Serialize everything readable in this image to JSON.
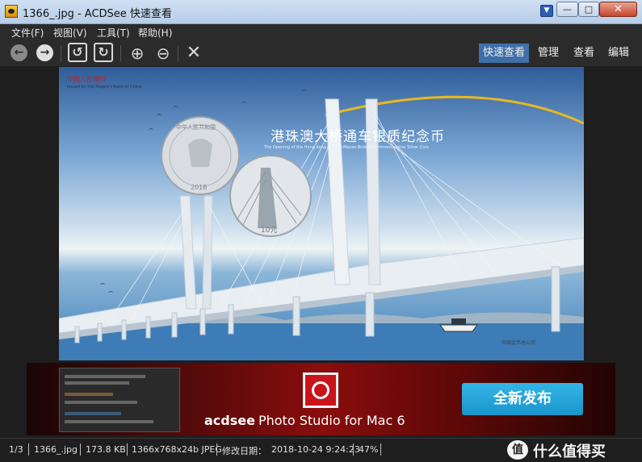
{
  "window": {
    "title": "1366_.jpg - ACDSee 快速查看",
    "minimize": "—",
    "maximize": "□",
    "close": "✕",
    "dropdown": "▼"
  },
  "menu": [
    {
      "label": "文件(F)"
    },
    {
      "label": "视图(V)"
    },
    {
      "label": "工具(T)"
    },
    {
      "label": "帮助(H)"
    }
  ],
  "toolbar": {
    "icons": {
      "back": "arrow-left-icon",
      "forward": "arrow-right-icon",
      "rotate_left": "rotate-left-icon",
      "rotate_right": "rotate-right-icon",
      "zoom_in": "zoom-in-icon",
      "zoom_out": "zoom-out-icon",
      "delete": "close-icon"
    },
    "glyphs": {
      "back": "←",
      "forward": "→",
      "rotate_left": "↺",
      "rotate_right": "↻",
      "zoom_in": "⊕",
      "zoom_out": "⊖",
      "delete": "✕"
    },
    "modes": [
      {
        "label": "快速查看",
        "active": true
      },
      {
        "label": "管理",
        "active": false
      },
      {
        "label": "查看",
        "active": false
      },
      {
        "label": "编辑",
        "active": false
      }
    ]
  },
  "photo": {
    "issuer_cn": "中国人民银行",
    "issuer_en": "Issued by the People's Bank of China",
    "headline_cn": "港珠澳大桥通车银质纪念币",
    "headline_en": "The Opening of the Hong Kong-Zhuhai-Macao Bridge Commemorative Silver Coin",
    "coin_front_text": "中华人民共和国",
    "coin_year": "2018",
    "coin_denomination": "10元",
    "maker_cn": "中国金币总公司",
    "colors": {
      "sky_top": "#2f5d9a",
      "bridge": "#e8eef3",
      "gold_arc": "#e8b820"
    }
  },
  "banner": {
    "cta_label": "全新发布",
    "product_brand": "acdsee",
    "product_name": "Photo Studio for Mac 6",
    "colors": {
      "bg": "#8a0d0d",
      "cta": "#1a95cc",
      "logo": "#c8141a"
    }
  },
  "status": {
    "index": "1/3",
    "filename": "1366_.jpg",
    "filesize": "173.8 KB",
    "dimensions": "1366x768x24b JPEG",
    "modified_label": "修改日期：",
    "modified_value": "2018-10-24 9:24:23",
    "zoom": "47%"
  },
  "watermark": {
    "badge": "值",
    "text": "什么值得买"
  }
}
